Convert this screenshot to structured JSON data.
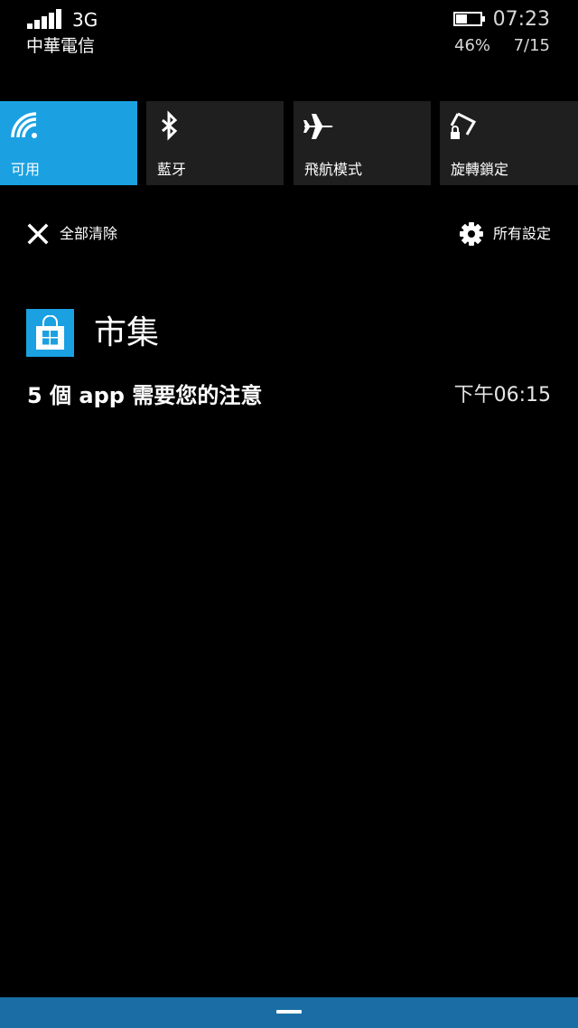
{
  "status_bar": {
    "signal_bars": 5,
    "network_type": "3G",
    "carrier": "中華電信",
    "battery_percent": "46%",
    "battery_level": 0.46,
    "time": "07:23",
    "date": "7/15"
  },
  "quick_actions": [
    {
      "label": "可用",
      "icon": "wifi-icon",
      "active": true
    },
    {
      "label": "藍牙",
      "icon": "bluetooth-icon",
      "active": false
    },
    {
      "label": "飛航模式",
      "icon": "airplane-icon",
      "active": false
    },
    {
      "label": "旋轉鎖定",
      "icon": "rotation-lock-icon",
      "active": false
    }
  ],
  "actions": {
    "clear_all": "全部清除",
    "all_settings": "所有設定"
  },
  "notification": {
    "app_name": "市集",
    "app_icon": "store-icon",
    "message": "5 個 app 需要您的注意",
    "time": "下午06:15"
  },
  "colors": {
    "accent": "#1ba1e2",
    "tile_background": "#1f1f1f",
    "bottom_bar": "#1a6ea5",
    "background": "#000000"
  }
}
